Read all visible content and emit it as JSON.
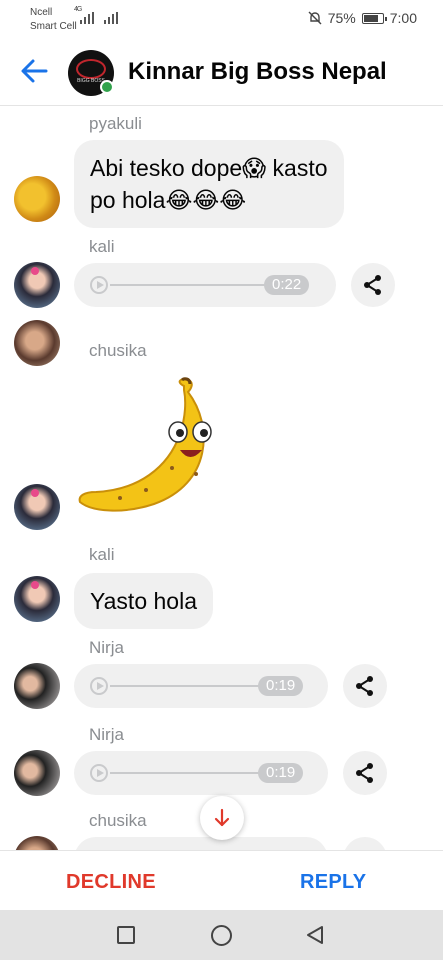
{
  "status_bar": {
    "carrier_1": "Ncell",
    "carrier_2": "Smart Cell",
    "network": "4G",
    "battery": "75%",
    "time": "7:00"
  },
  "header": {
    "title": "Kinnar Big Boss Nepal",
    "avatar_text": "BIGG BOSS"
  },
  "messages": [
    {
      "sender": "pyakuli",
      "type": "text",
      "line1": "Abi tesko dope😱 kasto",
      "line2": "po hola😂😂😂"
    },
    {
      "sender": "kali",
      "type": "audio",
      "duration": "0:22"
    },
    {
      "sender": "chusika",
      "type": "sticker",
      "sticker": "banana-sticker"
    },
    {
      "sender": "kali",
      "type": "text",
      "text": "Yasto hola"
    },
    {
      "sender": "Nirja",
      "type": "audio",
      "duration": "0:19"
    },
    {
      "sender": "Nirja",
      "type": "audio",
      "duration": "0:19"
    },
    {
      "sender": "chusika",
      "type": "audio",
      "duration": ""
    }
  ],
  "actions": {
    "decline": "DECLINE",
    "reply": "REPLY"
  },
  "colors": {
    "decline": "#e0392b",
    "reply": "#1a73e8",
    "online": "#31a24c",
    "bubble": "#f0f0f0"
  }
}
